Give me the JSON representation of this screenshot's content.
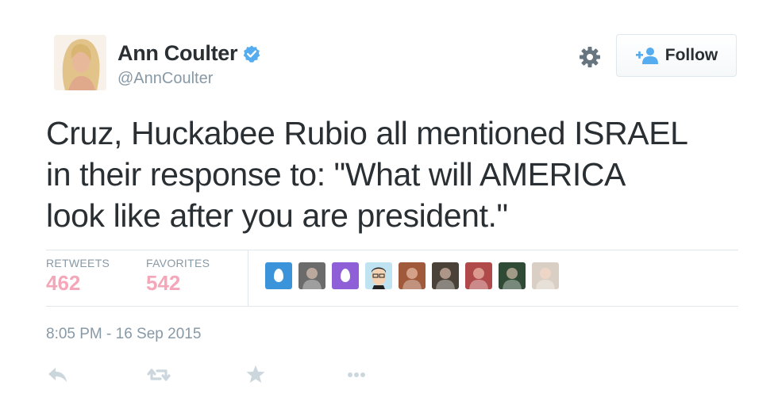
{
  "tweet": {
    "author_name": "Ann Coulter",
    "author_handle": "@AnnCoulter",
    "text_lines": [
      "Cruz, Huckabee Rubio all mentioned ISRAEL",
      "in their response to: \"What will AMERICA",
      "look like after you are president.\""
    ],
    "timestamp": "8:05 PM - 16 Sep 2015"
  },
  "follow_button": {
    "label": "Follow",
    "icon": "add-user-icon"
  },
  "settings": {
    "icon": "gear-icon"
  },
  "stats": {
    "retweets_label": "RETWEETS",
    "retweets_value": "462",
    "favorites_label": "FAVORITES",
    "favorites_value": "542"
  },
  "favoriters": [
    {
      "kind": "egg",
      "color": "#3b94d9"
    },
    {
      "kind": "photo",
      "color": "#6b6b6b"
    },
    {
      "kind": "egg",
      "color": "#8e5fd6"
    },
    {
      "kind": "cartoon",
      "color": "#bfe3f0"
    },
    {
      "kind": "photo",
      "color": "#a0593a"
    },
    {
      "kind": "photo",
      "color": "#4a4238"
    },
    {
      "kind": "photo",
      "color": "#b04a4a"
    },
    {
      "kind": "photo",
      "color": "#2f4a35"
    },
    {
      "kind": "photo",
      "color": "#d9cfc4"
    }
  ],
  "actions": [
    {
      "name": "reply-icon"
    },
    {
      "name": "retweet-icon"
    },
    {
      "name": "favorite-star-icon"
    },
    {
      "name": "more-options-icon"
    }
  ],
  "colors": {
    "text": "#292f33",
    "muted": "#8899a6",
    "stat_value": "#f4a7b9",
    "verified": "#55acee",
    "follow_icon": "#55acee",
    "action_icon": "#ccd6dd"
  }
}
